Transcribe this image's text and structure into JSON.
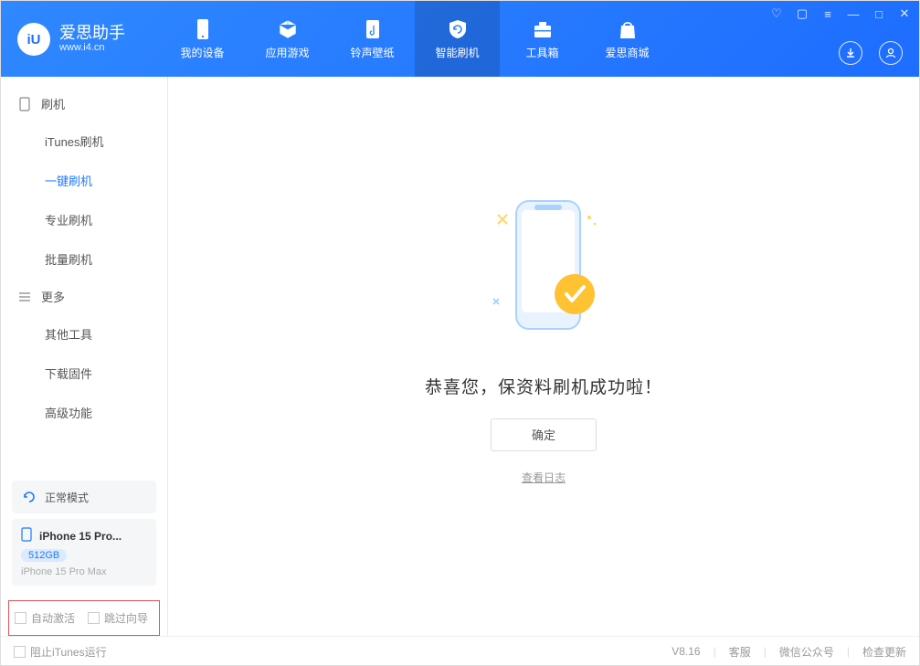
{
  "app": {
    "title": "爱思助手",
    "subtitle": "www.i4.cn"
  },
  "tabs": {
    "devices": "我的设备",
    "apps": "应用游戏",
    "ringtones": "铃声壁纸",
    "flash": "智能刷机",
    "toolbox": "工具箱",
    "store": "爱思商城"
  },
  "sidebar": {
    "group_flash": "刷机",
    "items_flash": {
      "itunes": "iTunes刷机",
      "onekey": "一键刷机",
      "pro": "专业刷机",
      "batch": "批量刷机"
    },
    "group_more": "更多",
    "items_more": {
      "other": "其他工具",
      "firmware": "下载固件",
      "advanced": "高级功能"
    }
  },
  "status": {
    "mode": "正常模式"
  },
  "device": {
    "name": "iPhone 15 Pro...",
    "capacity": "512GB",
    "full": "iPhone 15 Pro Max"
  },
  "options": {
    "auto_activate": "自动激活",
    "skip_guide": "跳过向导"
  },
  "main": {
    "message": "恭喜您，保资料刷机成功啦！",
    "ok": "确定",
    "log": "查看日志"
  },
  "footer": {
    "block_itunes": "阻止iTunes运行",
    "version": "V8.16",
    "support": "客服",
    "wechat": "微信公众号",
    "update": "检查更新"
  }
}
